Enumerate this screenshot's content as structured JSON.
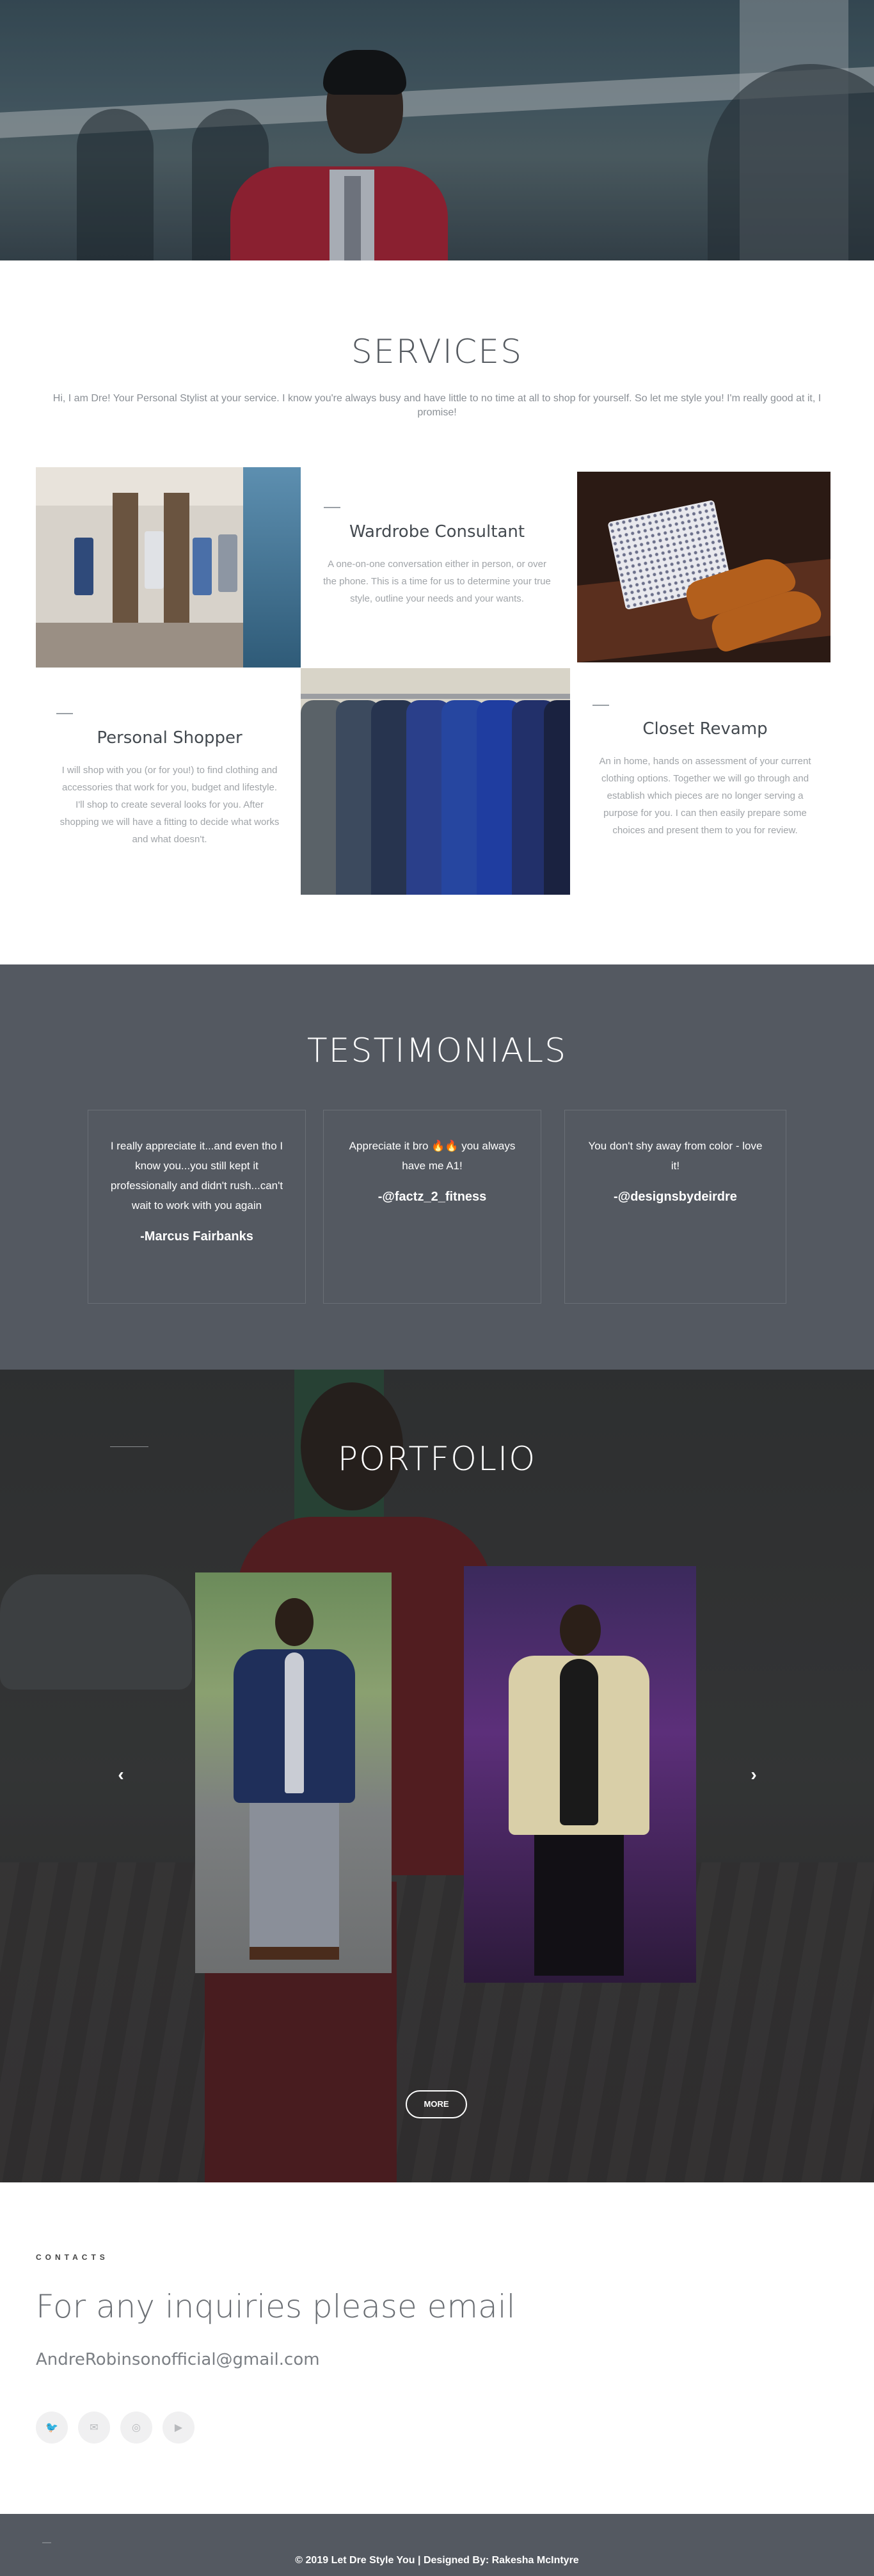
{
  "services": {
    "title": "SERVICES",
    "intro": "Hi, I am Dre! Your Personal Stylist at your service. I know you're always busy and have little to no time at all to shop for yourself. So let me style you! I'm really good at it, I promise!",
    "items": [
      {
        "title": "Wardrobe Consultant",
        "description": "A one-on-one conversation either in person, or over the phone. This is a time for us to determine your true style, outline your needs and your wants."
      },
      {
        "title": "Personal Shopper",
        "description": "I will shop with you (or for you!) to find clothing and accessories that work for you, budget and lifestyle.  I'll shop to create several looks for you. After shopping we will have a fitting to decide what works and what doesn't."
      },
      {
        "title": "Closet Revamp",
        "description": "An in home, hands on assessment of your current clothing options. Together we will go through and establish which pieces are no longer serving a purpose for you. I can then easily prepare some choices and present them to you for review."
      }
    ]
  },
  "testimonials": {
    "title": "TESTIMONIALS",
    "items": [
      {
        "quote": "I really appreciate it...and even tho I know you...you still kept it professionally and didn't rush...can't wait to work with you again",
        "author": "-Marcus Fairbanks"
      },
      {
        "quote": "Appreciate it bro 🔥🔥 you always have me A1!",
        "author": "-@factz_2_fitness"
      },
      {
        "quote": "You don't shy away from color - love it!",
        "author": "-@designsbydeirdre"
      }
    ]
  },
  "portfolio": {
    "title": "PORTFOLIO",
    "prev_label": "‹",
    "next_label": "›",
    "more_label": "MORE"
  },
  "contacts": {
    "label": "CONTACTS",
    "heading": "For any inquiries please email",
    "email": "AndreRobinsonofficial@gmail.com",
    "socials": [
      {
        "name": "twitter-icon",
        "glyph": "🐦"
      },
      {
        "name": "email-icon",
        "glyph": "✉"
      },
      {
        "name": "instagram-icon",
        "glyph": "◎"
      },
      {
        "name": "youtube-icon",
        "glyph": "▶"
      }
    ]
  },
  "footer": {
    "copyright": "© 2019 Let Dre Style You | Designed By: Rakesha McIntyre"
  }
}
